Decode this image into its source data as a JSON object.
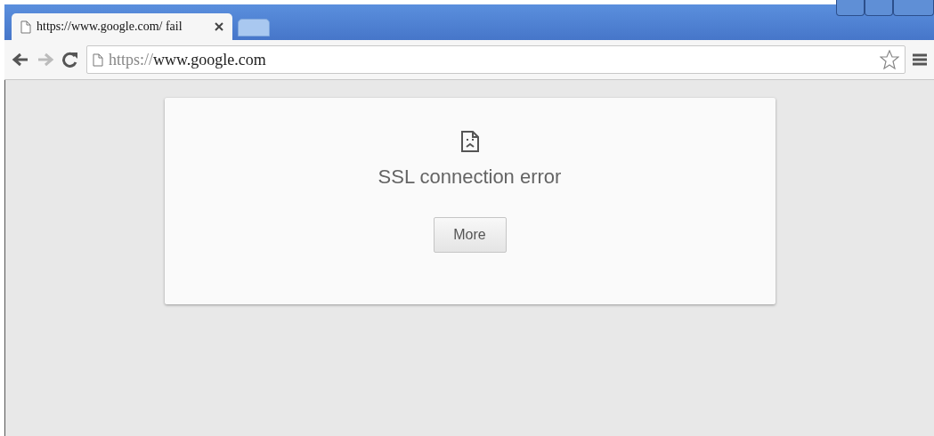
{
  "tabs": [
    {
      "title": "https://www.google.com/ fail",
      "selected": true
    },
    {
      "selected": false
    }
  ],
  "address_bar": {
    "scheme": "https://",
    "host": "www.google.com",
    "bookmarked": false
  },
  "error": {
    "title": "SSL connection error",
    "button": "More"
  }
}
